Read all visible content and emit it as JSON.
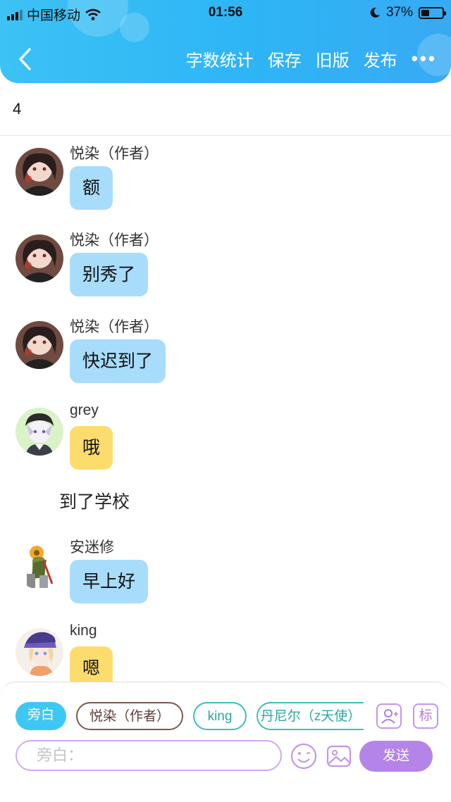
{
  "status_bar": {
    "carrier": "中国移动",
    "time": "01:56",
    "battery": "37%"
  },
  "nav": {
    "actions": [
      "字数统计",
      "保存",
      "旧版",
      "发布"
    ],
    "more": "•••"
  },
  "chapter_number": "4",
  "messages": [
    {
      "name": "悦染（作者）",
      "text": "额",
      "color": "blue"
    },
    {
      "name": "悦染（作者）",
      "text": "别秀了",
      "color": "blue"
    },
    {
      "name": "悦染（作者）",
      "text": "快迟到了",
      "color": "blue"
    },
    {
      "name": "grey",
      "text": "哦",
      "color": "yellow"
    },
    {
      "name": "安迷修",
      "text": "早上好",
      "color": "blue"
    },
    {
      "name": "king",
      "text": "嗯",
      "color": "yellow"
    }
  ],
  "narration": "到了学校",
  "bottom": {
    "tags": [
      "旁白",
      "悦染（作者）",
      "king",
      "丹尼尔（z天使）"
    ],
    "label_button": "标",
    "input_placeholder": "旁白：",
    "send_label": "发送"
  },
  "colors": {
    "header": "#2eb5f6",
    "bubble_blue": "#a8dcfb",
    "bubble_yellow": "#fddc6e",
    "send": "#b584e8",
    "active_tag": "#3ec7f4"
  }
}
